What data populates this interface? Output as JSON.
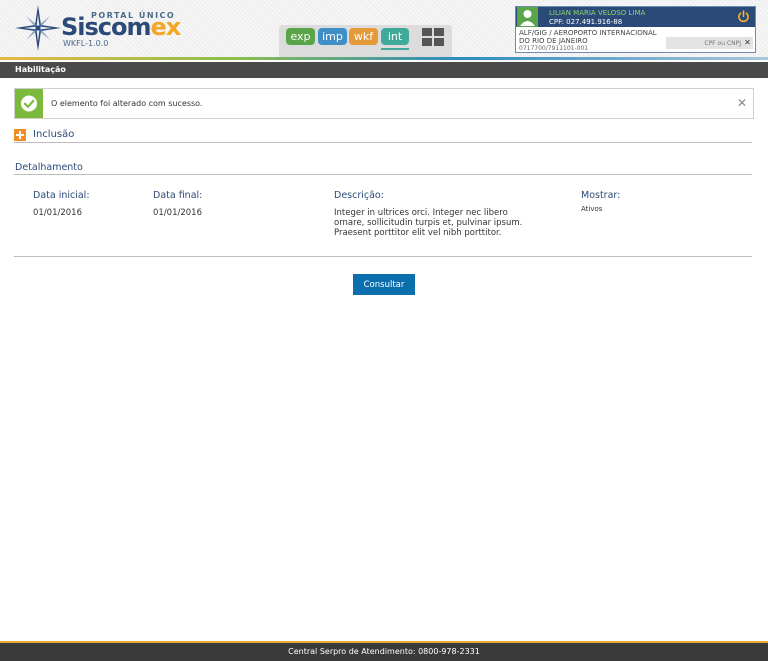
{
  "header": {
    "portal_label": "PORTAL ÚNICO",
    "brand_main": "Siscom",
    "brand_accent": "ex",
    "version": "WKFL-1.0.0",
    "modules": [
      {
        "label": "exp",
        "color": "#5aa54a"
      },
      {
        "label": "imp",
        "color": "#3f8fc6"
      },
      {
        "label": "wkf",
        "color": "#e59a3a"
      },
      {
        "label": "int",
        "color": "#40a99a"
      }
    ]
  },
  "user": {
    "name": "LILIAN MARIA VELOSO LIMA",
    "cpf": "CPF: 027.491.916-88",
    "org": "ALF/GIG / AEROPORTO INTERNACIONAL DO RIO DE JANEIRO",
    "code": "0717700/7911101-001",
    "search_placeholder": "CPF ou CNPJ"
  },
  "navbar": {
    "title": "Habilitação"
  },
  "alert": {
    "message": "O elemento foi alterado com sucesso."
  },
  "inclusao": {
    "label": "Inclusão"
  },
  "detalhamento": {
    "title": "Detalhamento",
    "fields": {
      "data_inicial_label": "Data inicial:",
      "data_inicial_value": "01/01/2016",
      "data_final_label": "Data final:",
      "data_final_value": "01/01/2016",
      "descricao_label": "Descrição:",
      "descricao_value": "Integer in ultrices orci. Integer nec libero ornare, sollicitudin turpis et, pulvinar ipsum. Praesent porttitor elit vel nibh porttitor.",
      "mostrar_label": "Mostrar:",
      "mostrar_value": "Ativos"
    }
  },
  "actions": {
    "consultar_label": "Consultar"
  },
  "footer": {
    "text": "Central Serpro de Atendimento: 0800-978-2331"
  },
  "colors": {
    "brand": "#2b4a77",
    "accent": "#f5a623",
    "success": "#7cba3d",
    "button": "#0b6fae"
  }
}
